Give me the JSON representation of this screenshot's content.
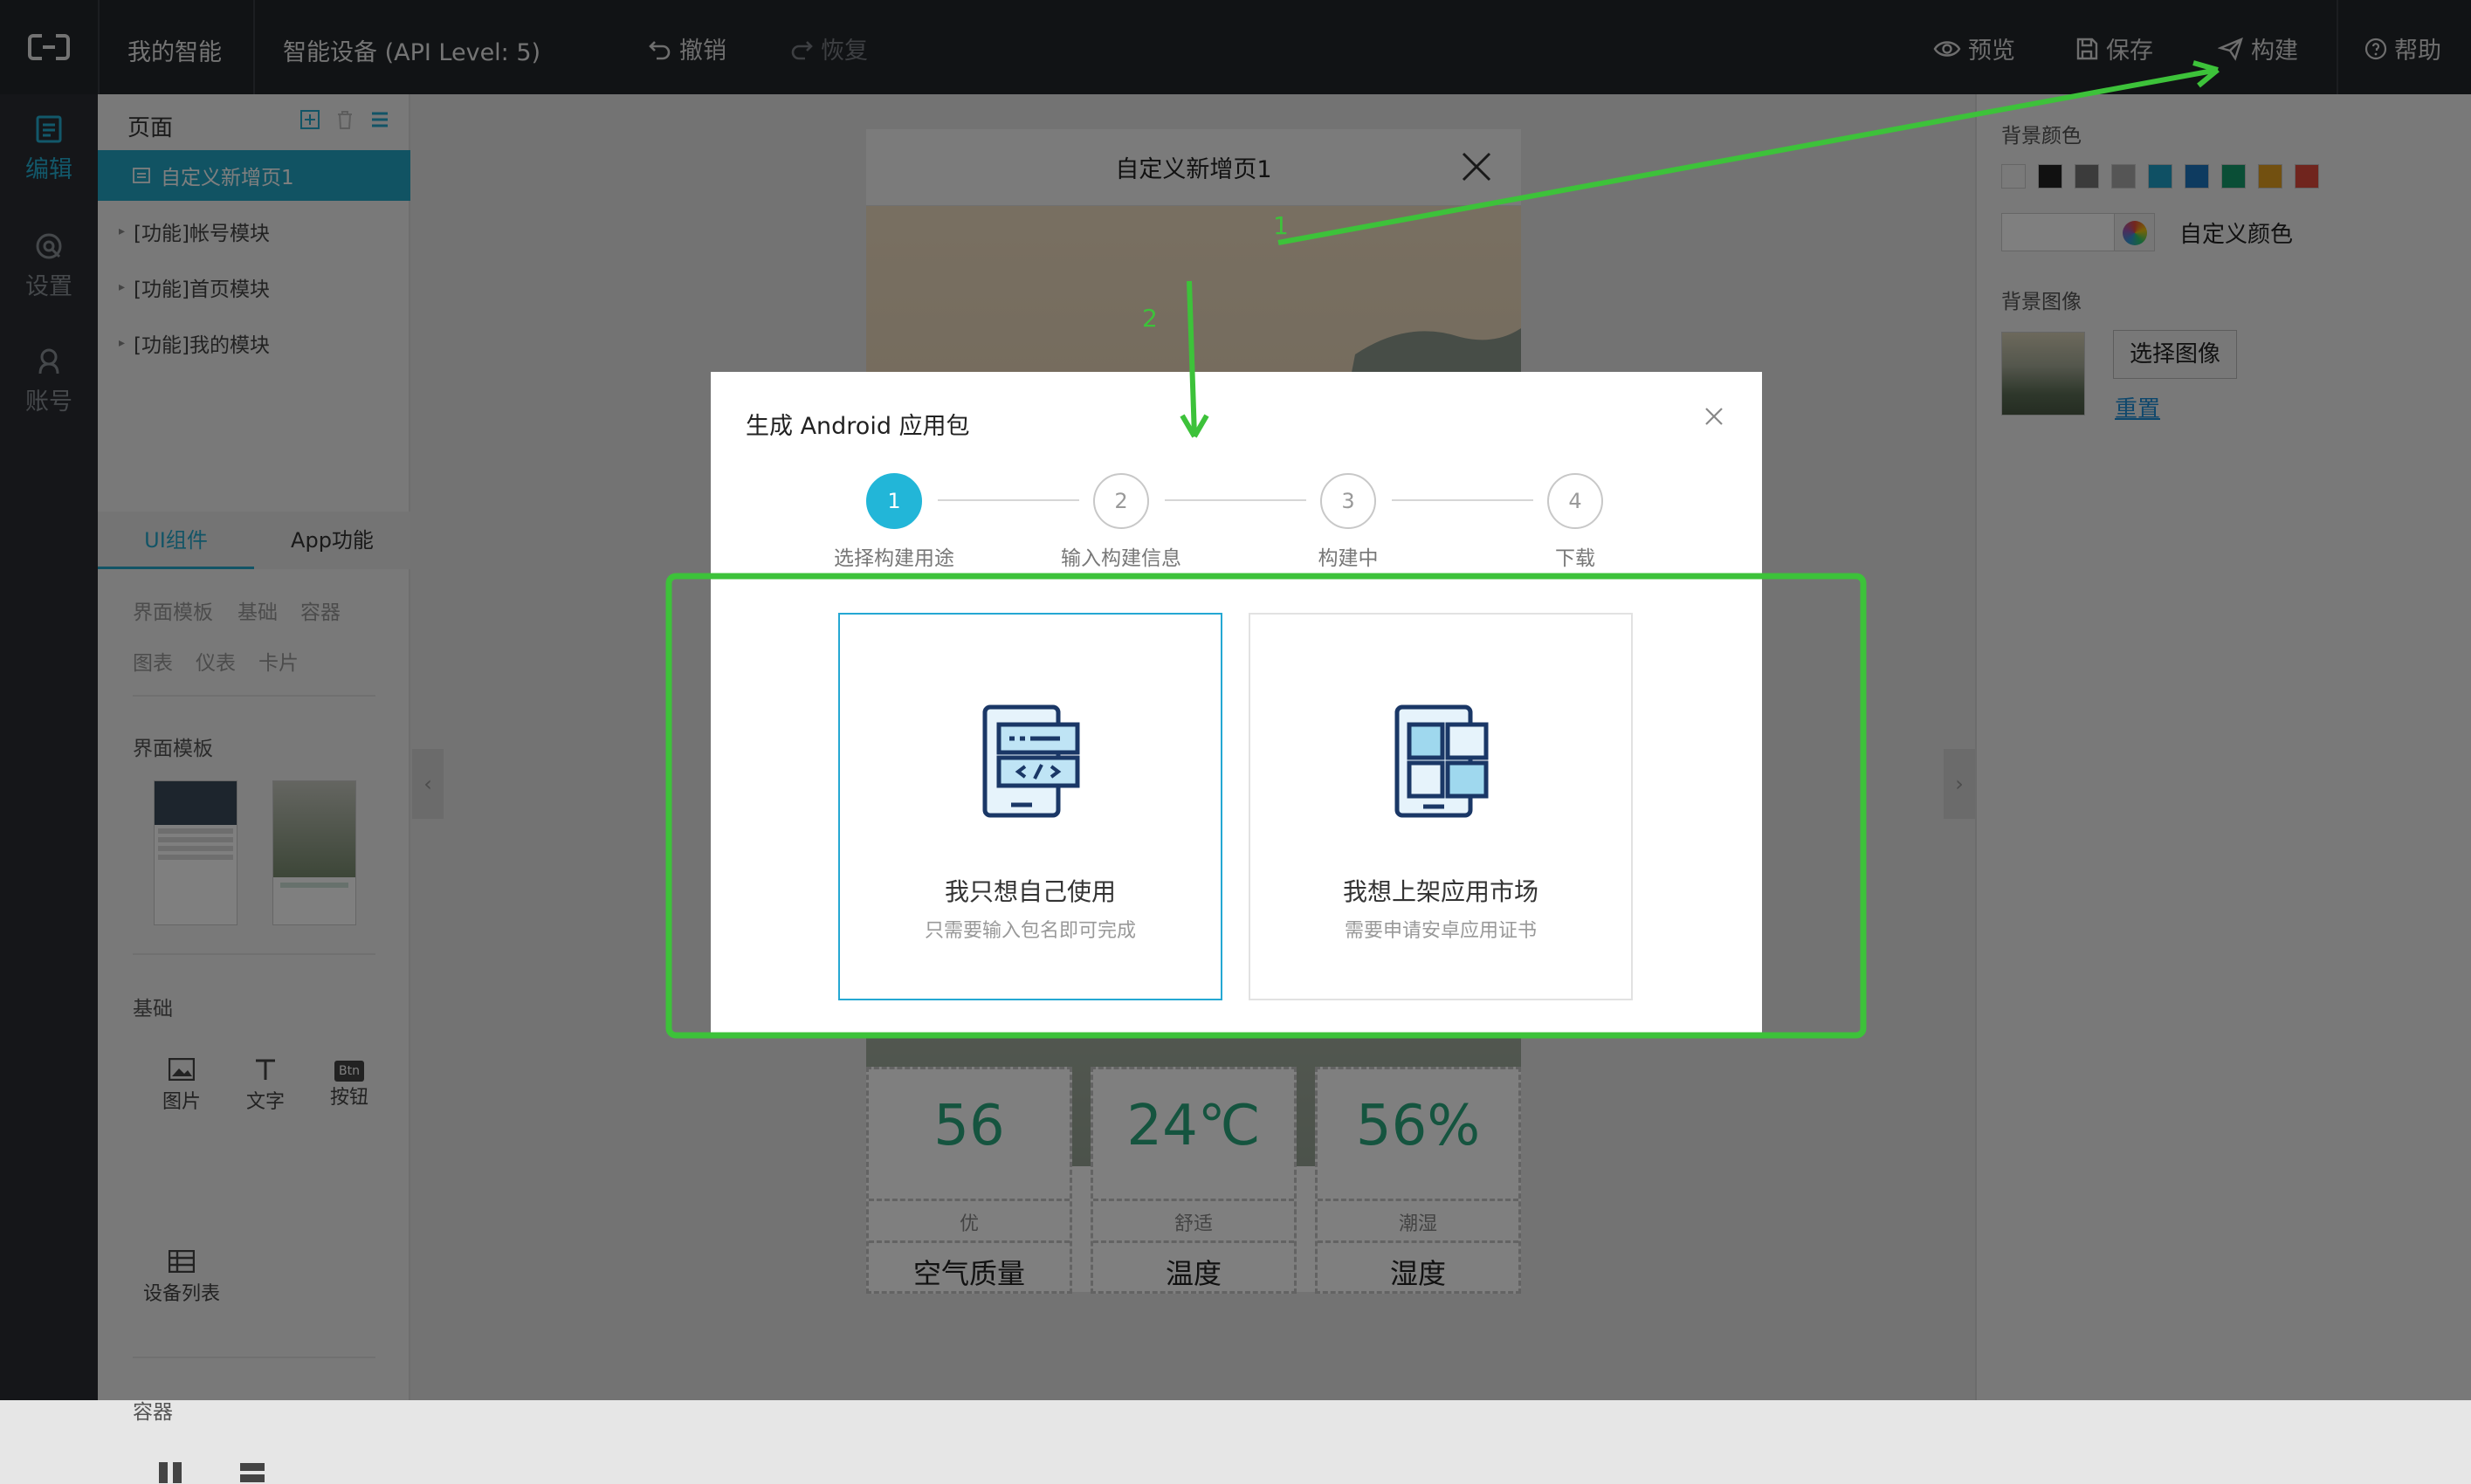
{
  "topbar": {
    "my_smart": "我的智能",
    "device": "智能设备 (API Level: 5)",
    "undo": "撤销",
    "redo": "恢复",
    "preview": "预览",
    "save": "保存",
    "build": "构建",
    "help": "帮助"
  },
  "leftnav": {
    "items": [
      {
        "label": "编辑",
        "icon": "edit-icon",
        "active": true
      },
      {
        "label": "设置",
        "icon": "settings-icon",
        "active": false
      },
      {
        "label": "账号",
        "icon": "account-icon",
        "active": false
      }
    ]
  },
  "pages": {
    "title": "页面",
    "items": [
      {
        "label": "自定义新增页1",
        "selected": true
      },
      {
        "label": "[功能]帐号模块"
      },
      {
        "label": "[功能]首页模块"
      },
      {
        "label": "[功能]我的模块"
      }
    ]
  },
  "components": {
    "tabs": [
      "UI组件",
      "App功能"
    ],
    "categories_row1": [
      "界面模板",
      "基础",
      "容器"
    ],
    "categories_row2": [
      "图表",
      "仪表",
      "卡片"
    ],
    "section_template": "界面模板",
    "section_basic": "基础",
    "basic_items": [
      "图片",
      "文字",
      "按钮",
      "设备列表"
    ],
    "btn_icon_text": "Btn",
    "section_container": "容器"
  },
  "phone": {
    "title": "自定义新增页1",
    "metrics": [
      {
        "value": "56",
        "sub": "优",
        "label": "空气质量"
      },
      {
        "value": "24℃",
        "sub": "舒适",
        "label": "温度"
      },
      {
        "value": "56%",
        "sub": "潮湿",
        "label": "湿度"
      }
    ]
  },
  "rightpanel": {
    "bg_color_title": "背景颜色",
    "swatches": [
      "#f5f5f5",
      "#222222",
      "#777777",
      "#aaaaaa",
      "#1ea1c9",
      "#1d76c1",
      "#149c6c",
      "#e5a020",
      "#e04a3c"
    ],
    "custom_color": "自定义颜色",
    "bg_image_title": "背景图像",
    "choose_image": "选择图像",
    "reset": "重置"
  },
  "modal": {
    "title": "生成 Android 应用包",
    "steps": [
      {
        "num": "1",
        "label": "选择构建用途"
      },
      {
        "num": "2",
        "label": "输入构建信息"
      },
      {
        "num": "3",
        "label": "构建中"
      },
      {
        "num": "4",
        "label": "下载"
      }
    ],
    "options": [
      {
        "title": "我只想自己使用",
        "desc": "只需要输入包名即可完成"
      },
      {
        "title": "我想上架应用市场",
        "desc": "需要申请安卓应用证书"
      }
    ]
  },
  "annotations": {
    "label1": "1",
    "label2": "2",
    "color": "#3dc23a"
  },
  "accent": "#22b6d8"
}
